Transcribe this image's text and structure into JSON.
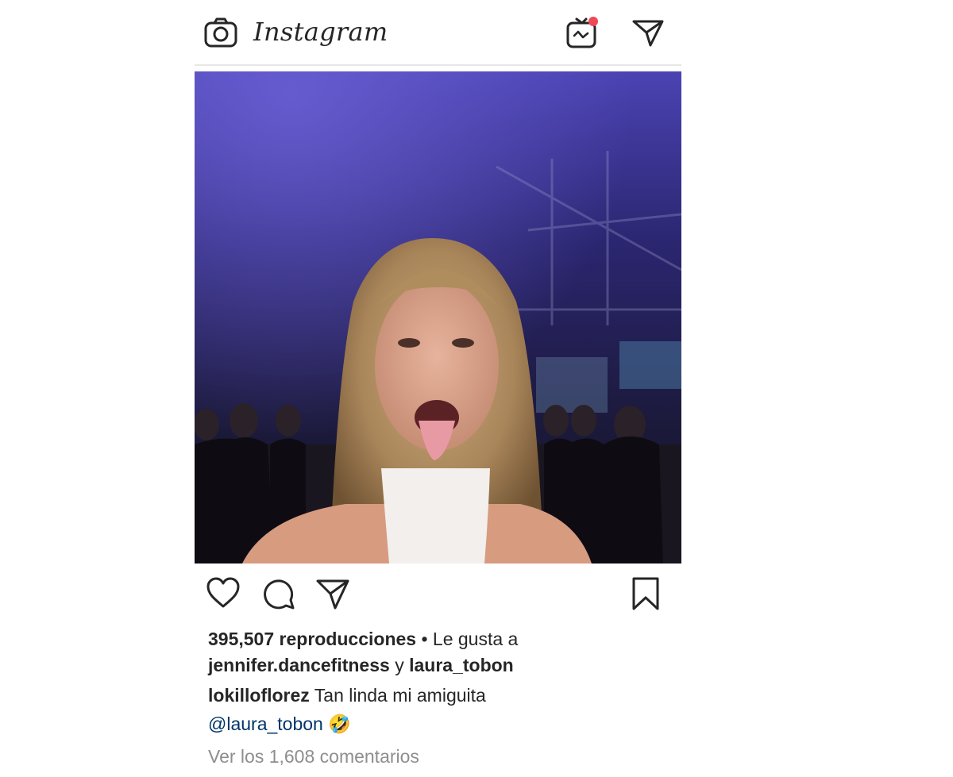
{
  "app": {
    "name": "Instagram"
  },
  "header": {
    "camera_icon": "camera-icon",
    "igtv_icon": "igtv-icon",
    "igtv_badge_color": "#ed4956",
    "direct_icon": "paper-plane-icon"
  },
  "post": {
    "media_type": "video",
    "actions": {
      "like_icon": "heart-icon",
      "comment_icon": "comment-icon",
      "share_icon": "paper-plane-icon",
      "save_icon": "bookmark-icon"
    },
    "views": "395,507 reproducciones",
    "views_separator": " • ",
    "liked_by_prefix": "Le gusta a",
    "liked_by_user1": "jennifer.dancefitness",
    "liked_by_joiner": " y ",
    "liked_by_user2": "laura_tobon",
    "caption_user": "lokilloflorez",
    "caption_text": " Tan linda mi amiguita",
    "caption_mention": "@laura_tobon",
    "caption_emoji": " 🤣",
    "view_comments": "Ver los 1,608 comentarios"
  },
  "colors": {
    "text": "#262626",
    "muted": "#8e8e8e",
    "mention": "#003569",
    "separator": "#e7e7e7"
  }
}
